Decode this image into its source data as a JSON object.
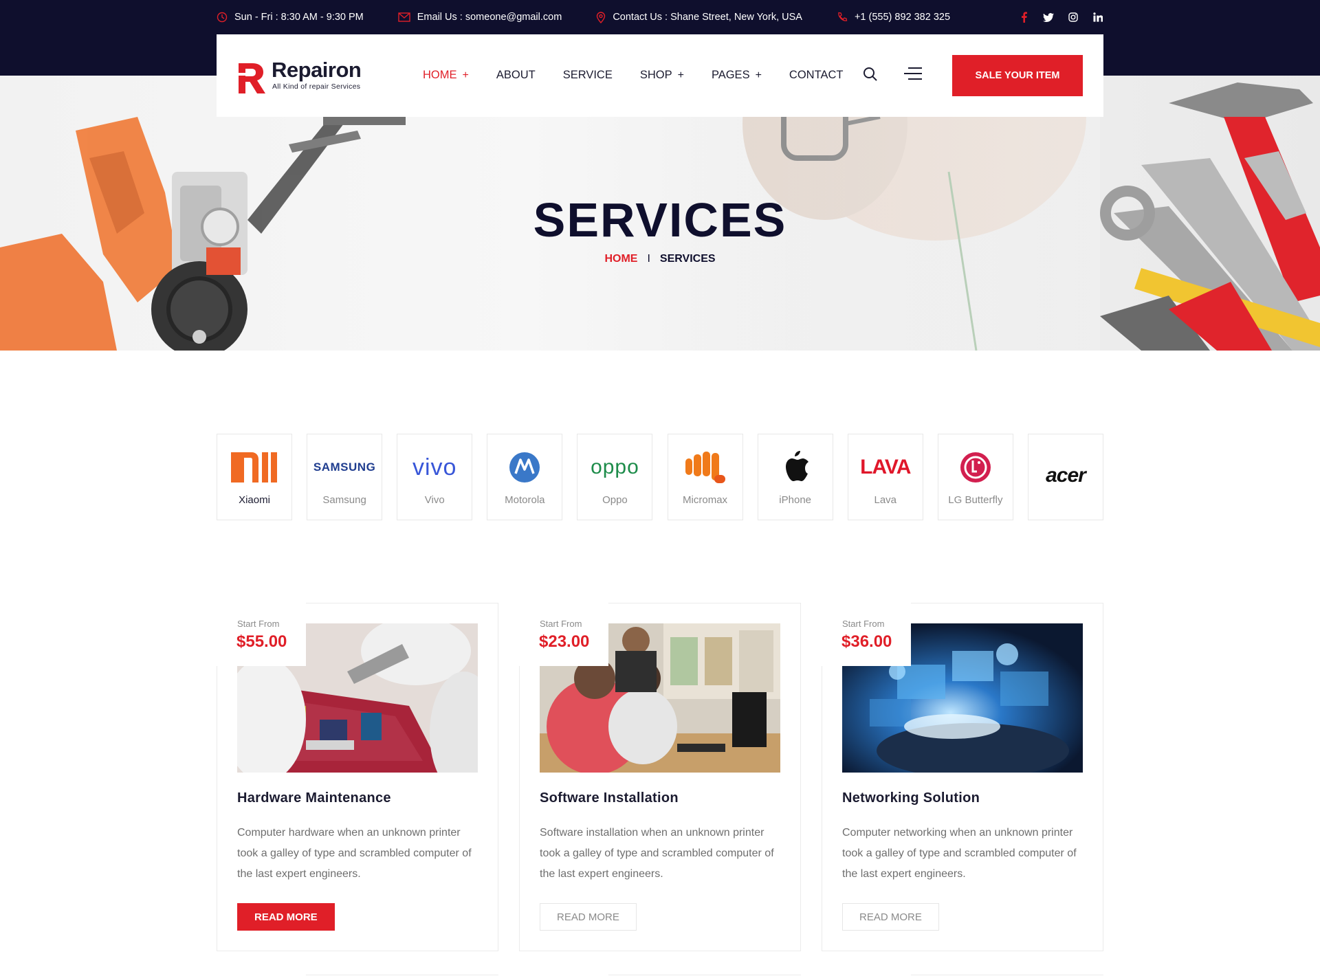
{
  "topbar": {
    "hours": "Sun - Fri : 8:30 AM - 9:30 PM",
    "email": "Email Us : someone@gmail.com",
    "address": "Contact Us : Shane Street, New York, USA",
    "phone": "+1 (555) 892 382 325",
    "social": [
      "facebook-icon",
      "twitter-icon",
      "instagram-icon",
      "linkedin-icon"
    ]
  },
  "header": {
    "logo_word": "Repairon",
    "logo_tag": "All Kind of repair Services",
    "nav": [
      {
        "label": "HOME",
        "plus": "+"
      },
      {
        "label": "ABOUT",
        "plus": ""
      },
      {
        "label": "SERVICE",
        "plus": ""
      },
      {
        "label": "SHOP",
        "plus": "+"
      },
      {
        "label": "PAGES",
        "plus": "+"
      },
      {
        "label": "CONTACT",
        "plus": ""
      }
    ],
    "sale_button": "SALE YOUR ITEM"
  },
  "hero": {
    "title": "SERVICES",
    "crumb_home": "HOME",
    "crumb_sep": "I",
    "crumb_current": "SERVICES"
  },
  "brands": [
    {
      "name": "Xiaomi",
      "logo_text": "mi"
    },
    {
      "name": "Samsung",
      "logo_text": "SAMSUNG"
    },
    {
      "name": "Vivo",
      "logo_text": "vivo"
    },
    {
      "name": "Motorola",
      "logo_text": ""
    },
    {
      "name": "Oppo",
      "logo_text": "oppo"
    },
    {
      "name": "Micromax",
      "logo_text": ""
    },
    {
      "name": "iPhone",
      "logo_text": ""
    },
    {
      "name": "Lava",
      "logo_text": "LAVA"
    },
    {
      "name": "LG Butterfly",
      "logo_text": ""
    },
    {
      "name": "",
      "logo_text": "acer"
    }
  ],
  "services": [
    {
      "start": "Start From",
      "price": "$55.00",
      "title": "Hardware Maintenance",
      "desc": "Computer hardware when an unknown printer took a galley of type and scrambled computer of the last expert engineers.",
      "button": "READ MORE"
    },
    {
      "start": "Start From",
      "price": "$23.00",
      "title": "Software Installation",
      "desc": "Software installation when an unknown printer took a galley of type and scrambled computer of the last expert engineers.",
      "button": "READ MORE"
    },
    {
      "start": "Start From",
      "price": "$36.00",
      "title": "Networking Solution",
      "desc": "Computer networking when an unknown printer took a galley of type and scrambled computer of the last expert engineers.",
      "button": "READ MORE"
    }
  ],
  "colors": {
    "accent": "#e01f28",
    "navy": "#0f0f2d"
  }
}
